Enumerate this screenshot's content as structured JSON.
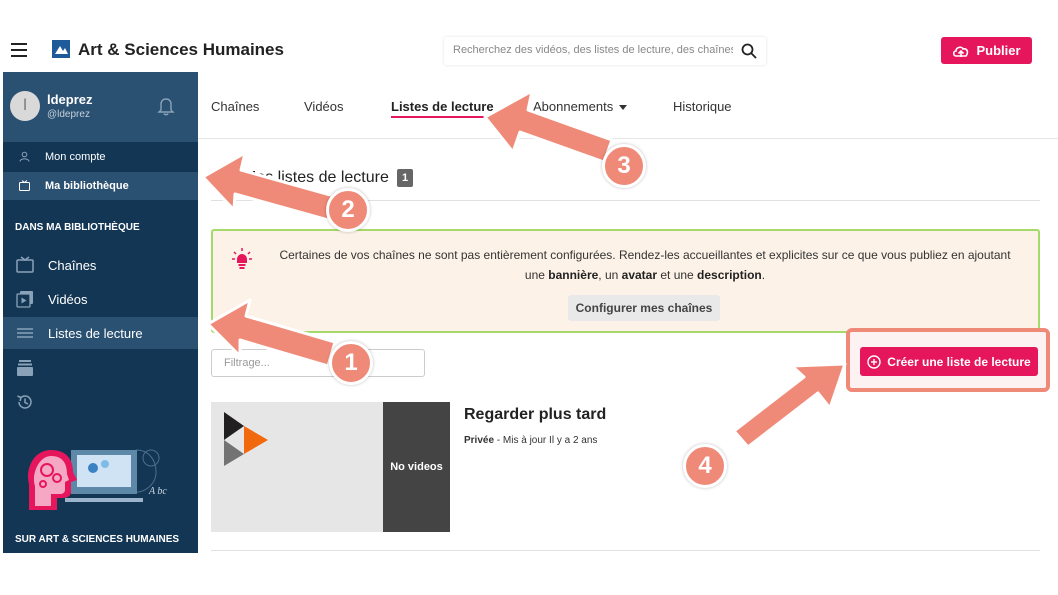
{
  "header": {
    "brand": "Art & Sciences Humaines",
    "search_placeholder": "Recherchez des vidéos, des listes de lecture, des chaînes",
    "publish_label": "Publier"
  },
  "sidebar": {
    "user": {
      "avatar_letter": "l",
      "name": "ldeprez",
      "handle": "@ldeprez"
    },
    "top_items": [
      {
        "label": "Mon compte",
        "icon": "user-icon"
      },
      {
        "label": "Ma bibliothèque",
        "icon": "library-icon",
        "active": true
      }
    ],
    "section_title": "DANS MA BIBLIOTHÈQUE",
    "items": [
      {
        "label": "Chaînes",
        "icon": "tv-icon"
      },
      {
        "label": "Vidéos",
        "icon": "video-icon"
      },
      {
        "label": "Listes de lecture",
        "icon": "list-icon",
        "active": true
      }
    ],
    "footer_section": "SUR ART & SCIENCES HUMAINES"
  },
  "tabs": [
    {
      "label": "Chaînes"
    },
    {
      "label": "Vidéos"
    },
    {
      "label": "Listes de lecture",
      "active": true
    },
    {
      "label": "Abonnements",
      "has_dropdown": true
    },
    {
      "label": "Historique"
    }
  ],
  "main": {
    "title": "Mes listes de lecture",
    "count": "1",
    "alert": {
      "text_1": "Certaines de vos chaînes ne sont pas entièrement configurées. Rendez-les accueillantes et explicites sur ce que vous publiez en ajoutant une ",
      "bold_1": "bannière",
      "text_2": ", un ",
      "bold_2": "avatar",
      "text_3": " et une ",
      "bold_3": "description",
      "text_4": ".",
      "button_label": "Configurer mes chaînes"
    },
    "filter_placeholder": "Filtrage...",
    "create_label": "Créer une liste de lecture",
    "playlist": {
      "thumb_label": "No videos",
      "title": "Regarder plus tard",
      "privacy": "Privée",
      "updated": " - Mis à jour Il y a 2 ans"
    }
  },
  "annotations": [
    "1",
    "2",
    "3",
    "4"
  ],
  "colors": {
    "accent": "#e5165c",
    "sidebar_bg": "#133655",
    "sidebar_active": "#2a5072",
    "annotation": "#f08a78",
    "alert_bg": "#fdf2e7",
    "alert_border": "#a6d96a"
  }
}
